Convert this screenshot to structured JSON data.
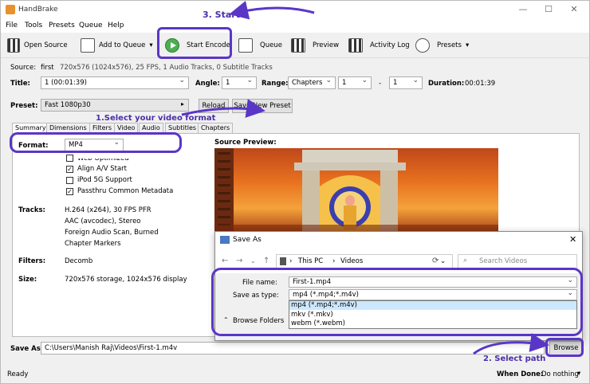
{
  "window": {
    "title": "HandBrake"
  },
  "menu": [
    "File",
    "Tools",
    "Presets",
    "Queue",
    "Help"
  ],
  "toolbar": {
    "open_source": "Open Source",
    "add_to_queue": "Add to Queue",
    "start_encode": "Start Encode",
    "queue": "Queue",
    "preview": "Preview",
    "activity_log": "Activity Log",
    "presets": "Presets"
  },
  "source": {
    "label": "Source:",
    "name": "first",
    "info": "720x576 (1024x576), 25 FPS, 1 Audio Tracks, 0 Subtitle Tracks"
  },
  "title_row": {
    "title_label": "Title:",
    "title_value": "1 (00:01:39)",
    "angle_label": "Angle:",
    "angle_value": "1",
    "range_label": "Range:",
    "range_value": "Chapters",
    "range_start": "1",
    "range_sep": "-",
    "range_end": "1",
    "duration_label": "Duration:",
    "duration_value": "00:01:39"
  },
  "preset": {
    "label": "Preset:",
    "value": "Fast 1080p30",
    "reload": "Reload",
    "save_new": "Save New Preset"
  },
  "tabs": [
    "Summary",
    "Dimensions",
    "Filters",
    "Video",
    "Audio",
    "Subtitles",
    "Chapters"
  ],
  "summary": {
    "format_label": "Format:",
    "format_value": "MP4",
    "options": [
      {
        "label": "Web Optimized",
        "checked": false
      },
      {
        "label": "Align A/V Start",
        "checked": true
      },
      {
        "label": "iPod 5G Support",
        "checked": false
      },
      {
        "label": "Passthru Common Metadata",
        "checked": true
      }
    ],
    "tracks_label": "Tracks:",
    "tracks": [
      "H.264 (x264), 30 FPS PFR",
      "AAC (avcodec), Stereo",
      "Foreign Audio Scan, Burned",
      "Chapter Markers"
    ],
    "filters_label": "Filters:",
    "filters_value": "Decomb",
    "size_label": "Size:",
    "size_value": "720x576 storage, 1024x576 display",
    "preview_label": "Source Preview:"
  },
  "save_as": {
    "label": "Save As:",
    "path": "C:\\Users\\Manish Raj\\Videos\\First-1.m4v",
    "browse": "Browse"
  },
  "dialog": {
    "title": "Save As",
    "close": "✕",
    "breadcrumb": [
      "This PC",
      "Videos"
    ],
    "search_placeholder": "Search Videos",
    "file_name_label": "File name:",
    "file_name_value": "First-1.mp4",
    "save_type_label": "Save as type:",
    "save_type_value": "mp4 (*.mp4;*.m4v)",
    "type_options": [
      "mp4 (*.mp4;*.m4v)",
      "mkv (*.mkv)",
      "webm (*.webm)"
    ],
    "browse_folders": "Browse Folders"
  },
  "status": {
    "ready": "Ready",
    "when_done_label": "When Done:",
    "when_done_value": "Do nothing"
  },
  "annotations": {
    "start": "3. Start",
    "select_format": "1.Select your video format",
    "select_path": "2. Select path"
  },
  "colors": {
    "annotation": "#5a36c7",
    "highlight": "#cce8ff",
    "encode_green": "#4caf50"
  }
}
